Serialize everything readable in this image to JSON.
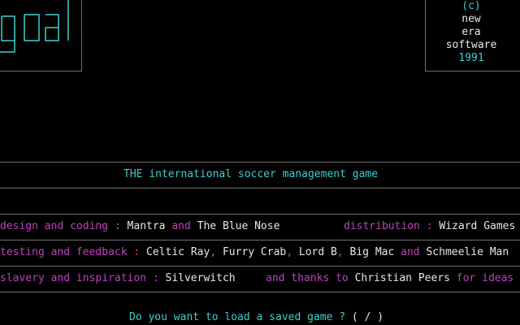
{
  "logo": {
    "text": "goal",
    "color": "#3ccfcf"
  },
  "copyright": {
    "c": "(c)",
    "new": "new",
    "era": "era",
    "software": "software",
    "year": "1991"
  },
  "tagline": "THE international soccer management game",
  "credits": {
    "row1": {
      "label": "design and coding",
      "sep": " : ",
      "name1": "Mantra",
      "and": " and ",
      "name2": "The Blue Nose",
      "label2": "distribution",
      "sep2": " : ",
      "name3": "Wizard Games"
    },
    "row2": {
      "label": "testing and feedback",
      "sep": " : ",
      "name1": "Celtic Ray",
      "comma1": ", ",
      "name2": "Furry Crab",
      "comma2": ", ",
      "name3": "Lord B",
      "comma3": ", ",
      "name4": "Big Mac",
      "and": " and ",
      "name5": "Schmeelie Man"
    },
    "row3": {
      "label": "slavery and inspiration",
      "sep": " : ",
      "name1": "Silverwitch",
      "thanks": "and thanks to",
      "name2": "Christian Peers",
      "for": " for ideas"
    }
  },
  "prompt": {
    "question": "Do you want to load a saved game ?",
    "choices": " ( / )"
  },
  "colors": {
    "cyan": "#3ccfcf",
    "magenta": "#c040c0",
    "white": "#e8e8e8",
    "rule": "#707070"
  }
}
